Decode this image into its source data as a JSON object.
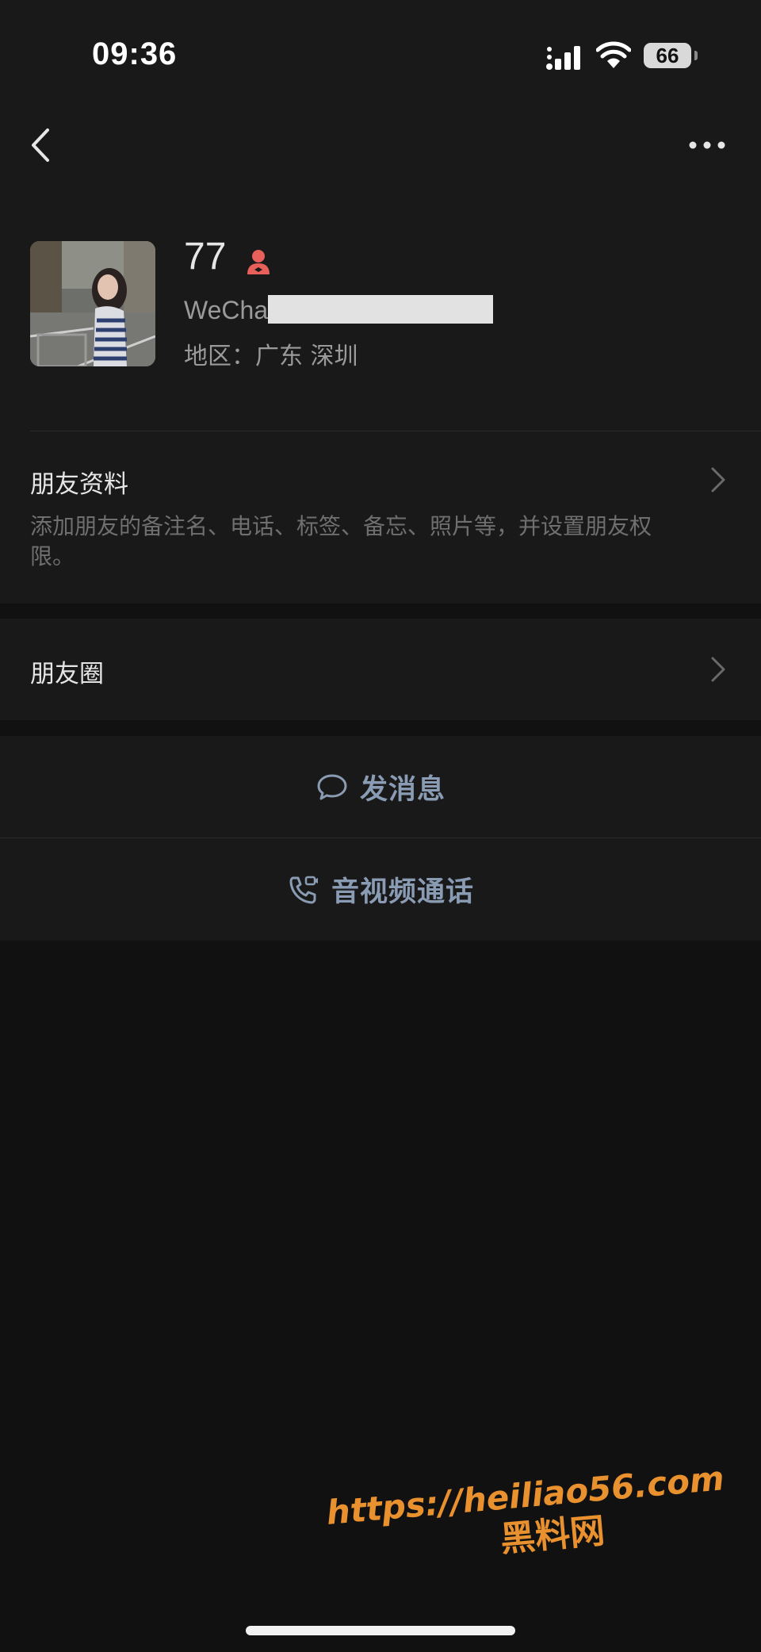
{
  "status_bar": {
    "time": "09:36",
    "battery": "66"
  },
  "nav": {
    "back_icon": "chevron-left-icon",
    "more_icon": "more-dots-icon"
  },
  "profile": {
    "nickname": "77",
    "gender_icon": "female-icon",
    "gender_color": "#e8605a",
    "wechat_id_prefix": "WeCha",
    "region": "地区：广东 深圳"
  },
  "friend_info": {
    "title": "朋友资料",
    "description": "添加朋友的备注名、电话、标签、备忘、照片等，并设置朋友权限。"
  },
  "moments": {
    "title": "朋友圈"
  },
  "actions": {
    "message_label": "发消息",
    "message_icon": "chat-bubble-icon",
    "call_label": "音视频通话",
    "call_icon": "phone-video-icon",
    "accent": "#8a9bb4"
  },
  "watermark": {
    "url": "https://heiliao56.com",
    "name": "黑料网",
    "color": "#e8912e"
  },
  "colors": {
    "background": "#111111",
    "panel": "#191919"
  }
}
